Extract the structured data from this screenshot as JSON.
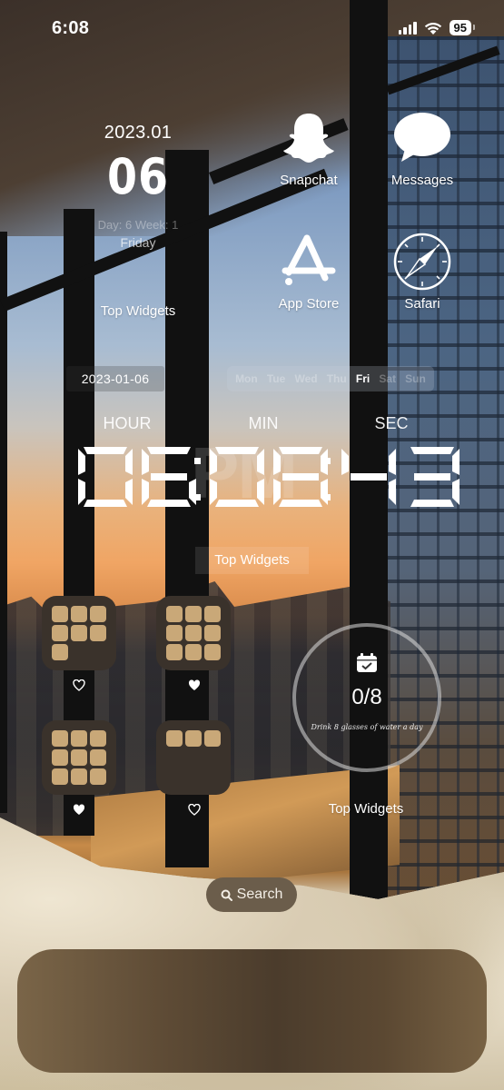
{
  "status_bar": {
    "time": "6:08",
    "battery": "95",
    "signal_icon": "cellular-signal-icon",
    "wifi_icon": "wifi-icon"
  },
  "date_widget": {
    "year_month": "2023.01",
    "day": "06",
    "day_week": "Day: 6 Week: 1",
    "weekday": "Friday",
    "label": "Top Widgets"
  },
  "apps": [
    {
      "label": "Snapchat",
      "icon": "snapchat-ghost-icon"
    },
    {
      "label": "Messages",
      "icon": "speech-bubble-icon"
    },
    {
      "label": "App Store",
      "icon": "app-store-icon"
    },
    {
      "label": "Safari",
      "icon": "compass-icon"
    }
  ],
  "calendar_strip": {
    "date": "2023-01-06",
    "weekdays": [
      "Mon",
      "Tue",
      "Wed",
      "Thu",
      "Fri",
      "Sat",
      "Sun"
    ],
    "active": "Fri"
  },
  "clock": {
    "labels": {
      "hour": "HOUR",
      "min": "MIN",
      "sec": "SEC"
    },
    "meridiem": "PM",
    "hour": "06",
    "minute": "08",
    "second": "43",
    "label": "Top Widgets"
  },
  "folders": [
    {
      "name": "folder-1",
      "app_count": 7,
      "favorite": false
    },
    {
      "name": "folder-2",
      "app_count": 9,
      "favorite": true
    },
    {
      "name": "folder-3",
      "app_count": 9,
      "favorite": true
    },
    {
      "name": "folder-4",
      "app_count": 3,
      "favorite": false
    }
  ],
  "water_widget": {
    "icon": "calendar-check-icon",
    "count": "0/8",
    "progress": 0,
    "hint": "Drink 8 glasses of water a day",
    "label": "Top Widgets"
  },
  "search": {
    "label": "Search",
    "icon": "search-icon"
  },
  "dock": {
    "apps": []
  },
  "colors": {
    "folder_bg": "#3a322b",
    "folder_tile": "#c9a878",
    "search_bg": "#6b5d4b",
    "dock_bg": "#5b4832"
  }
}
